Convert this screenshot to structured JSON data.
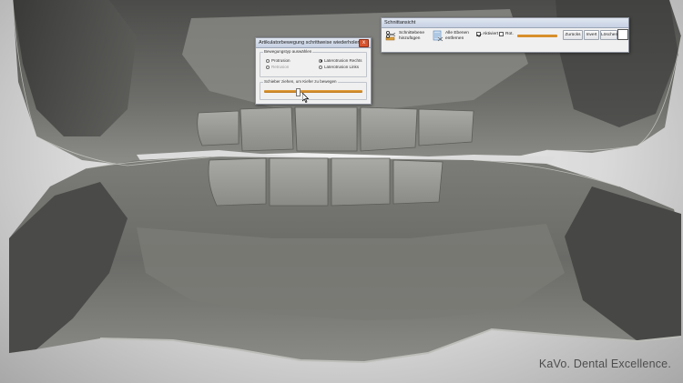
{
  "articulator_dialog": {
    "title": "Artikulatorbewegung schrittweise wiederholen",
    "close_glyph": "x",
    "movement_group_label": "Bewegungstyp auswählen",
    "options": [
      {
        "label": "Protrusion",
        "selected": false,
        "enabled": true
      },
      {
        "label": "Retrusion",
        "selected": false,
        "enabled": false
      },
      {
        "label": "Laterotrusion Rechts",
        "selected": true,
        "enabled": true
      },
      {
        "label": "Laterotrusion Links",
        "selected": false,
        "enabled": true
      }
    ],
    "slider_group_label": "Schieber ziehen, um Kiefer zu bewegen",
    "slider_fraction": 0.34
  },
  "schnitt_panel": {
    "title": "Schnittansicht",
    "add_plane_label_1": "Schnittebene",
    "add_plane_label_2": "hinzufügen",
    "remove_all_label_1": "Alle Ebenen",
    "remove_all_label_2": "entfernen",
    "aktiviert_label": "Aktiviert",
    "aktiviert_checked": true,
    "rot_label": "Rot.",
    "rot_checked": false,
    "slider_fraction": 1.0,
    "buttons": [
      "Zurücks",
      "Invert",
      "Löschen"
    ],
    "color_swatch": "#ffffff"
  },
  "brand_text": "KaVo. Dental Excellence.",
  "colors": {
    "slider_accent": "#d88f2c",
    "close_button": "#d8542f",
    "model_gray": "#6e6e6c",
    "background": "#e6e6e6"
  }
}
